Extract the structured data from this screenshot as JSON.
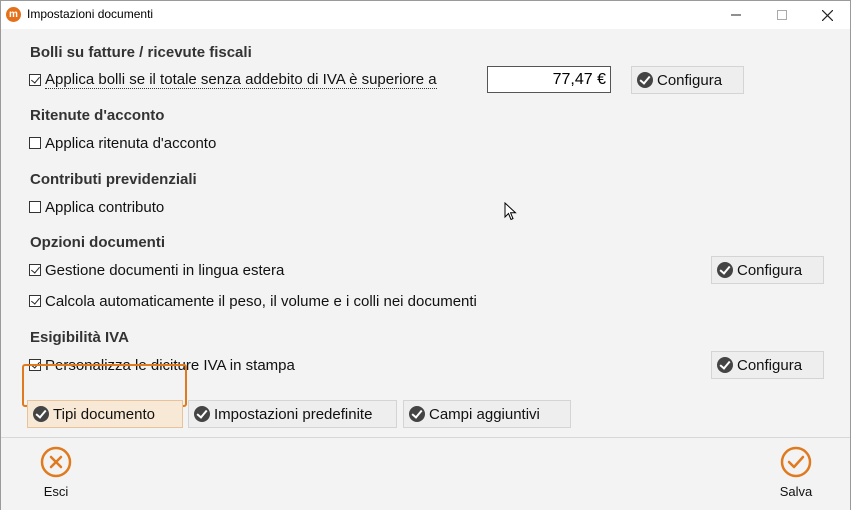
{
  "window": {
    "title": "Impostazioni documenti",
    "app_icon": "m"
  },
  "sections": {
    "bolli": {
      "title": "Bolli su fatture / ricevute fiscali",
      "checkbox_label": "Applica bolli se il totale senza addebito di IVA è superiore a",
      "checked": true,
      "amount": "77,47 €",
      "config_label": "Configura"
    },
    "ritenute": {
      "title": "Ritenute d'acconto",
      "checkbox_label": "Applica ritenuta d'acconto",
      "checked": false
    },
    "contributi": {
      "title": "Contributi previdenziali",
      "checkbox_label": "Applica contributo",
      "checked": false
    },
    "opzioni": {
      "title": "Opzioni documenti",
      "lingua_label": "Gestione documenti in lingua estera",
      "lingua_checked": true,
      "lingua_config_label": "Configura",
      "peso_label": "Calcola automaticamente il peso, il volume e i colli nei documenti",
      "peso_checked": true
    },
    "iva": {
      "title": "Esigibilità IVA",
      "checkbox_label": "Personalizza le diciture IVA in stampa",
      "checked": true,
      "config_label": "Configura"
    }
  },
  "bottom_buttons": {
    "tipi": "Tipi documento",
    "predefinite": "Impostazioni predefinite",
    "campi": "Campi aggiuntivi"
  },
  "footer": {
    "cancel_label": "Esci",
    "save_label": "Salva",
    "accent_color": "#e07a1f"
  }
}
